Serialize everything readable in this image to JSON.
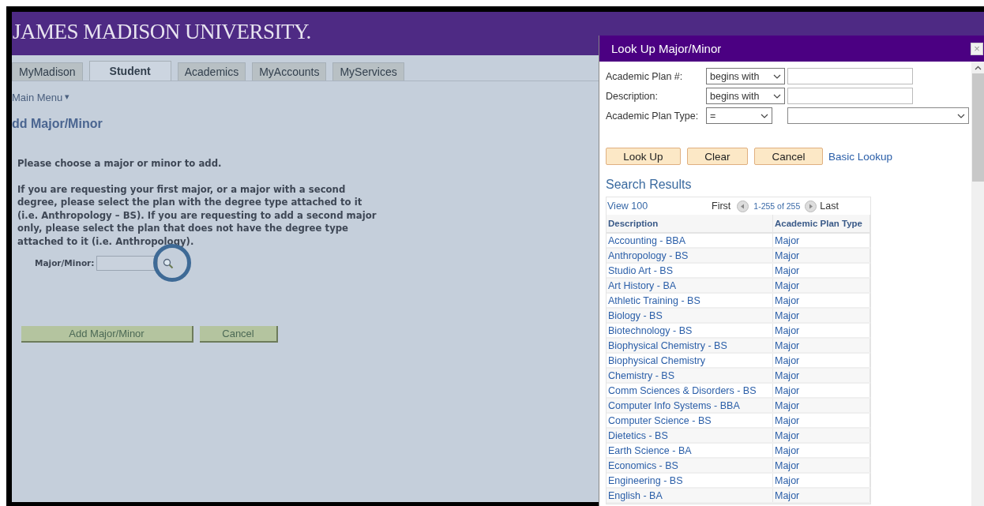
{
  "header": {
    "title": "JAMES MADISON UNIVERSITY."
  },
  "tabs": [
    {
      "label": "MyMadison",
      "selected": false
    },
    {
      "label": "Student",
      "selected": true
    },
    {
      "label": "Academics",
      "selected": false
    },
    {
      "label": "MyAccounts",
      "selected": false
    },
    {
      "label": "MyServices",
      "selected": false
    }
  ],
  "main_menu": {
    "label": "Main Menu",
    "caret": "▾"
  },
  "page": {
    "title": "dd Major/Minor",
    "intro": "Please choose a major or minor to add.",
    "instructions": "If you are requesting your first major, or a major with a second degree, please select the plan with the degree type attached to it (i.e. Anthropology – BS). If you are requesting to add a second major only, please select the plan that does not have the degree type attached to it (i.e. Anthropology).",
    "field_label": "Major/Minor:",
    "buttons": [
      "Add Major/Minor",
      "Cancel"
    ]
  },
  "dialog": {
    "title": "Look Up Major/Minor",
    "close": "×",
    "criteria": [
      {
        "label": "Academic Plan #:",
        "operator": "begins with",
        "kind": "text"
      },
      {
        "label": "Description:",
        "operator": "begins with",
        "kind": "text"
      },
      {
        "label": "Academic Plan Type:",
        "operator": "=",
        "kind": "select"
      }
    ],
    "buttons": [
      "Look Up",
      "Clear",
      "Cancel"
    ],
    "link": "Basic Lookup",
    "results_title": "Search Results",
    "grid": {
      "view": "View 100",
      "first": "First",
      "range": "1-255 of 255",
      "last": "Last",
      "columns": [
        "Description",
        "Academic Plan Type"
      ],
      "rows": [
        [
          "Accounting - BBA",
          "Major"
        ],
        [
          "Anthropology - BS",
          "Major"
        ],
        [
          "Studio Art - BS",
          "Major"
        ],
        [
          "Art History - BA",
          "Major"
        ],
        [
          "Athletic Training - BS",
          "Major"
        ],
        [
          "Biology - BS",
          "Major"
        ],
        [
          "Biotechnology - BS",
          "Major"
        ],
        [
          "Biophysical Chemistry - BS",
          "Major"
        ],
        [
          "Biophysical Chemistry",
          "Major"
        ],
        [
          "Chemistry - BS",
          "Major"
        ],
        [
          "Comm Sciences & Disorders - BS",
          "Major"
        ],
        [
          "Computer Info Systems - BBA",
          "Major"
        ],
        [
          "Computer Science - BS",
          "Major"
        ],
        [
          "Dietetics - BS",
          "Major"
        ],
        [
          "Earth Science - BA",
          "Major"
        ],
        [
          "Economics - BS",
          "Major"
        ],
        [
          "Engineering - BS",
          "Major"
        ],
        [
          "English - BA",
          "Major"
        ]
      ]
    }
  }
}
